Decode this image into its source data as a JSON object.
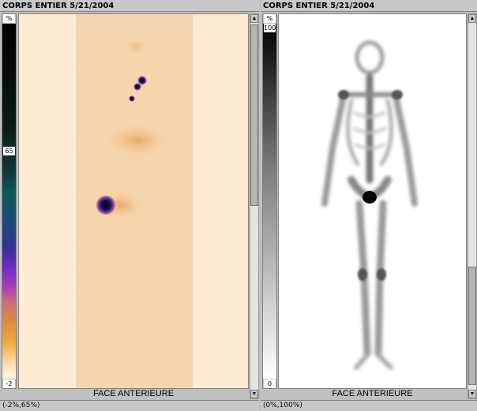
{
  "left_panel": {
    "title": "CORPS ENTIER 5/21/2004",
    "scale": {
      "top_label": "%",
      "mid_label": "65",
      "bottom_label": "-2"
    },
    "view_label": "FACE ANTERIEURE",
    "status": "(-2%,65%)",
    "colormap": "thermal"
  },
  "right_panel": {
    "title": "CORPS ENTIER 5/21/2004",
    "scale": {
      "top_label": "%",
      "mid_label": "100",
      "bottom_label": "0"
    },
    "view_label": "FACE ANTERIEURE",
    "status": "(0%,100%)",
    "colormap": "grayscale"
  },
  "icons": {
    "scroll_up": "arrow-up-icon",
    "scroll_down": "arrow-down-icon"
  },
  "colors": {
    "left_background": "#fdebd3",
    "hot_spot": "#1a1050",
    "uptake": "#e0a060"
  }
}
